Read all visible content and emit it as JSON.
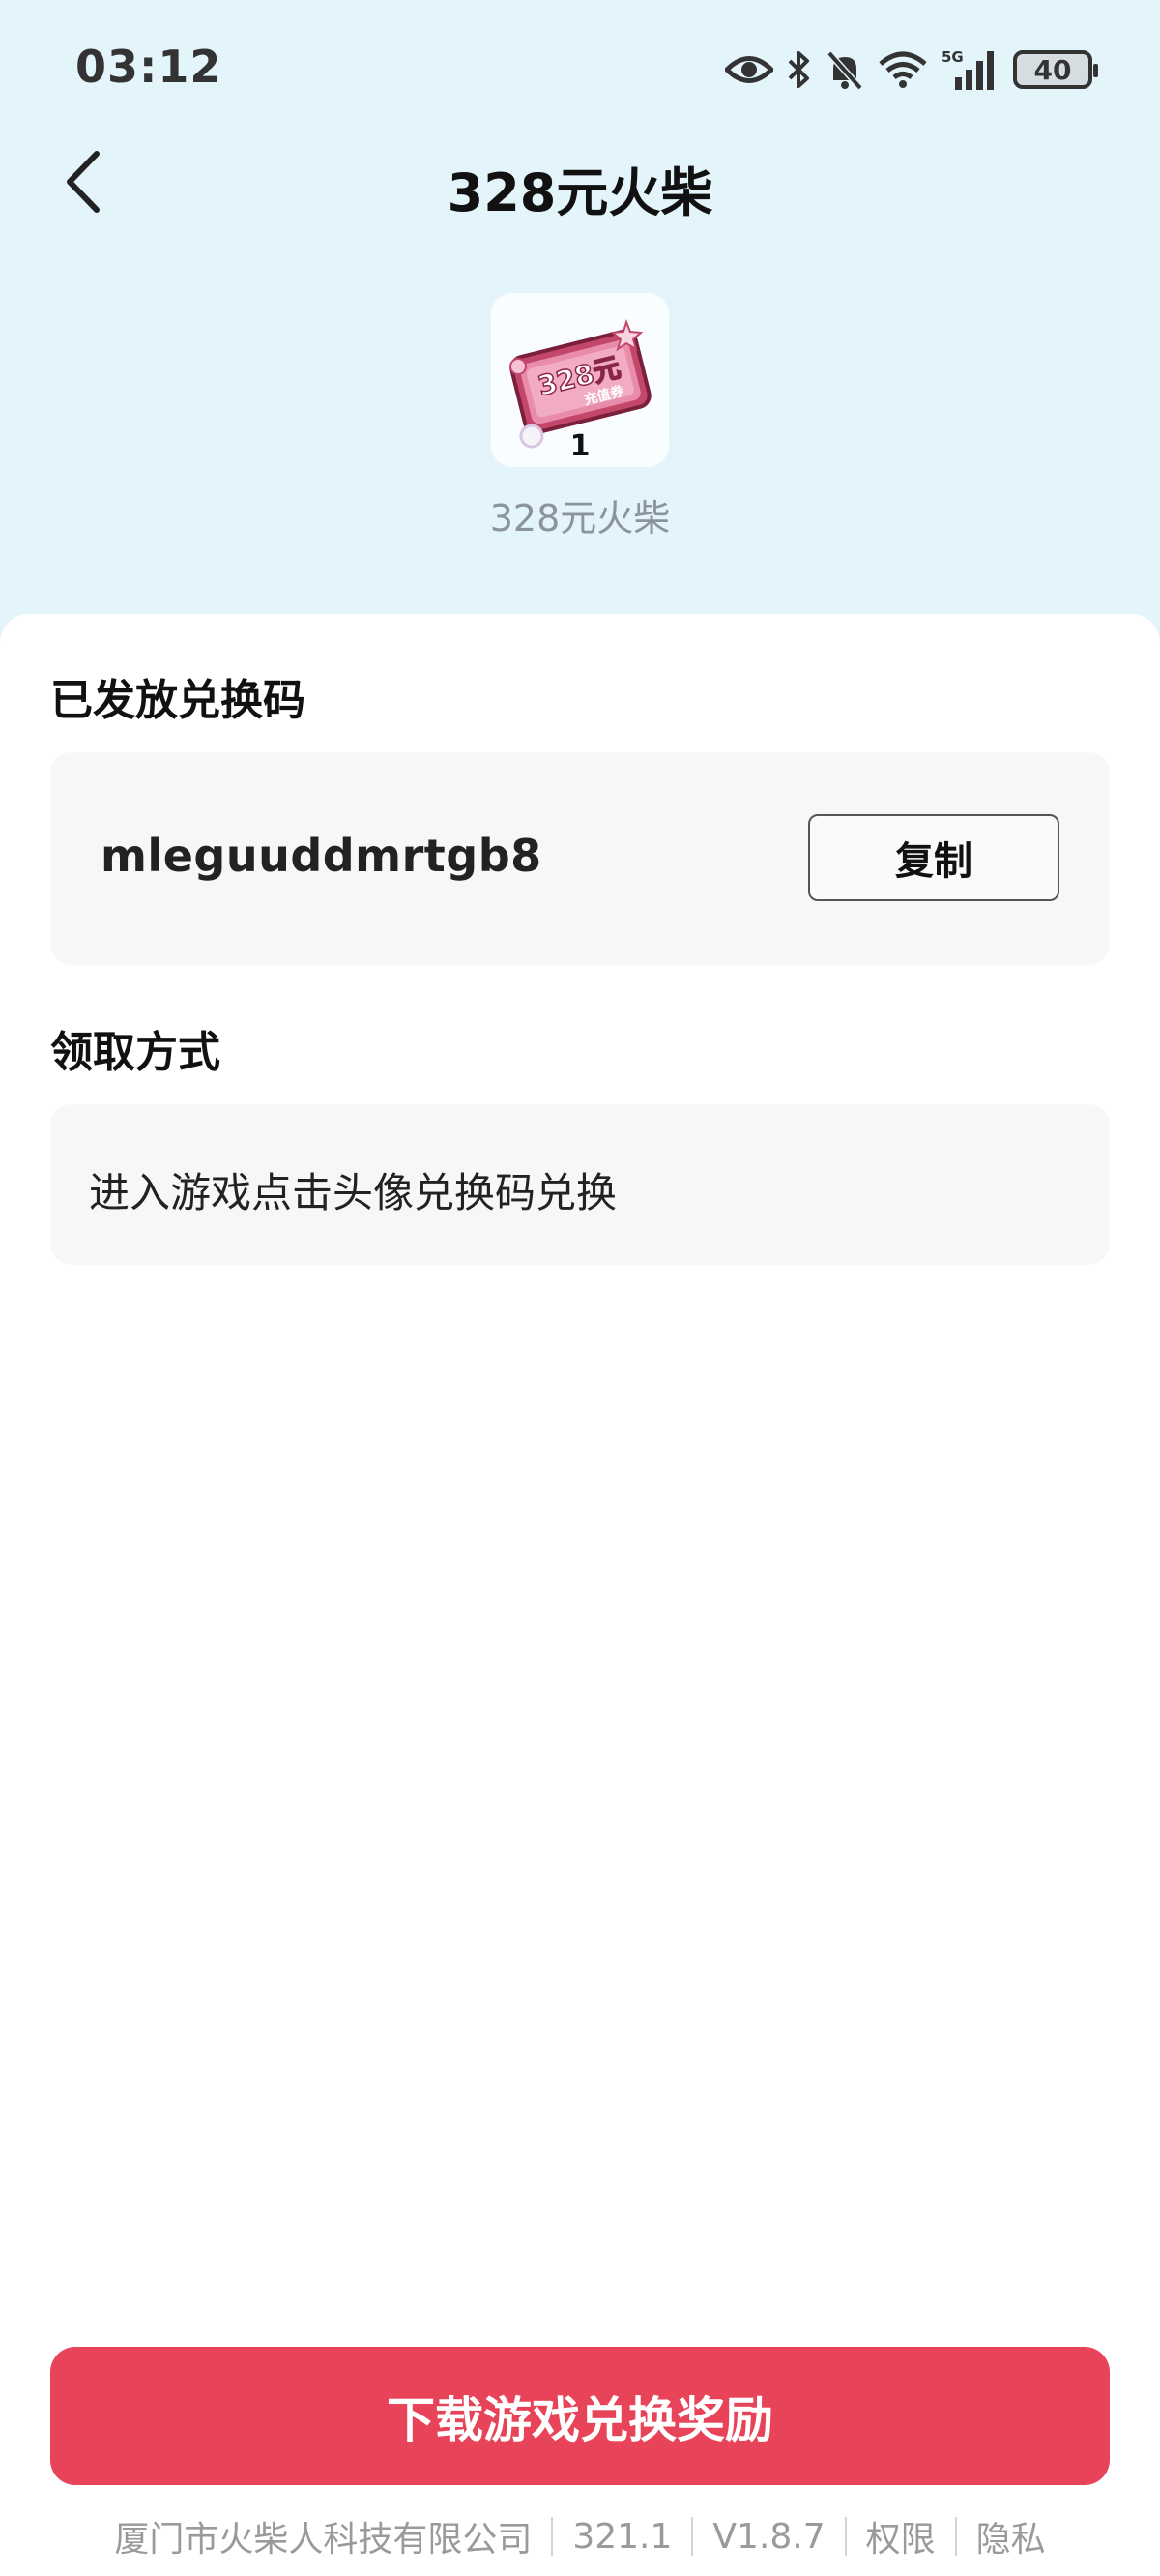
{
  "status_bar": {
    "time": "03:12",
    "icons": [
      "eye-icon",
      "bluetooth-icon",
      "bell-muted-icon",
      "wifi-icon",
      "signal-5g-icon"
    ],
    "battery": "40"
  },
  "header": {
    "title": "328元火柴"
  },
  "item": {
    "quantity": "1",
    "name": "328元火柴",
    "image_text": "328元",
    "image_subtext": "充值券"
  },
  "redeem": {
    "section_title": "已发放兑换码",
    "code": "mleguuddmrtgb8",
    "copy_label": "复制"
  },
  "method": {
    "section_title": "领取方式",
    "text": "进入游戏点击头像兑换码兑换"
  },
  "cta": {
    "label": "下载游戏兑换奖励"
  },
  "footer": {
    "company": "厦门市火柴人科技有限公司",
    "build": "321.1",
    "version": "V1.8.7",
    "permissions": "权限",
    "privacy": "隐私"
  },
  "colors": {
    "hero_background": "#e4f4fb",
    "cta_red": "#e84459",
    "box_grey": "#f7f7f7"
  }
}
